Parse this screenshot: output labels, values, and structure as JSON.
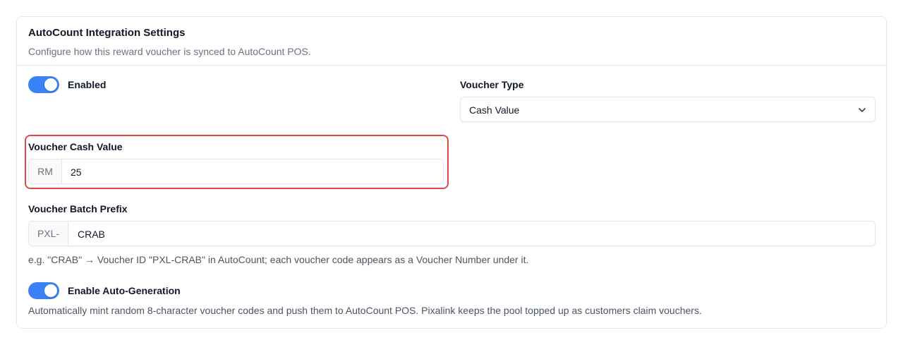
{
  "card": {
    "title": "AutoCount Integration Settings",
    "description": "Configure how this reward voucher is synced to AutoCount POS."
  },
  "enabled_toggle": {
    "label": "Enabled",
    "on": true
  },
  "voucher_type": {
    "label": "Voucher Type",
    "selected": "Cash Value"
  },
  "voucher_cash_value": {
    "label": "Voucher Cash Value",
    "prefix": "RM",
    "value": "25"
  },
  "voucher_batch_prefix": {
    "label": "Voucher Batch Prefix",
    "prefix": "PXL-",
    "value": "CRAB",
    "help": "e.g. \"CRAB\" → Voucher ID \"PXL-CRAB\" in AutoCount; each voucher code appears as a Voucher Number under it."
  },
  "auto_generation_toggle": {
    "label": "Enable Auto-Generation",
    "on": true,
    "help": "Automatically mint random 8-character voucher codes and push them to AutoCount POS. Pixalink keeps the pool topped up as customers claim vouchers."
  },
  "colors": {
    "accent": "#3b82f6",
    "highlight": "#e04848"
  }
}
